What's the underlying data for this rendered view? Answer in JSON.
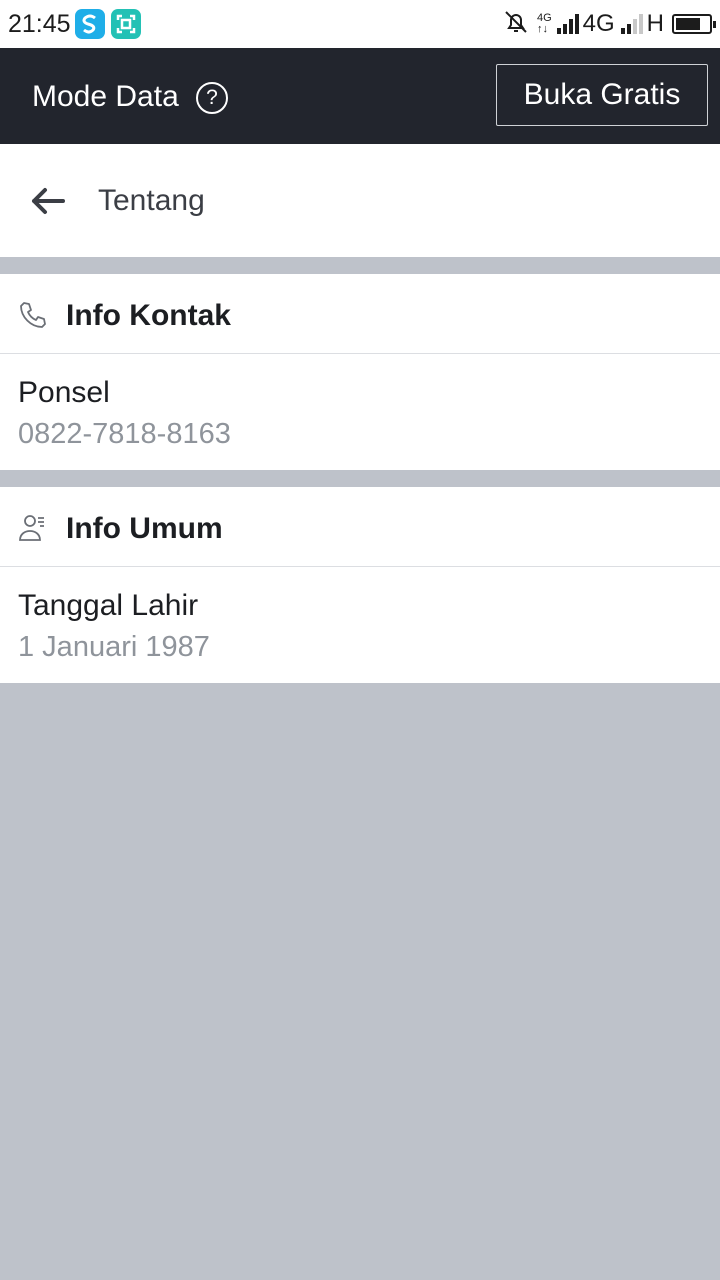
{
  "status_bar": {
    "time": "21:45",
    "net1_type": "4G",
    "net2_type": "4G",
    "net3_type": "H",
    "battery_level": 0.75,
    "icons": [
      "app-s-icon",
      "scan-icon",
      "bell-off-icon",
      "signal-icon",
      "battery-icon"
    ]
  },
  "header": {
    "title": "Mode Data",
    "help_symbol": "?",
    "open_free_label": "Buka Gratis"
  },
  "nav": {
    "title": "Tentang"
  },
  "contact_section": {
    "title": "Info Kontak",
    "items": [
      {
        "label": "Ponsel",
        "value": "0822-7818-8163"
      }
    ]
  },
  "general_section": {
    "title": "Info Umum",
    "items": [
      {
        "label": "Tanggal Lahir",
        "value": "1 Januari 1987"
      }
    ]
  },
  "colors": {
    "header_bg": "#22252d",
    "page_bg": "#bec2ca",
    "value_text": "#8f949b"
  }
}
